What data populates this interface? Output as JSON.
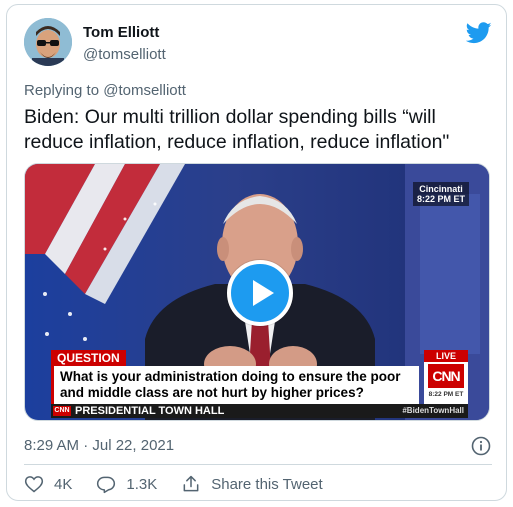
{
  "author": {
    "name": "Tom Elliott",
    "handle": "@tomselliott"
  },
  "replying_to": {
    "prefix": "Replying to",
    "mention": "@tomselliott"
  },
  "tweet": {
    "text": "Biden: Our multi trillion dollar spending bills “will reduce inflation, reduce inflation, reduce inflation\"",
    "timestamp": "8:29 AM · Jul 22, 2021"
  },
  "video": {
    "location": "Cincinnati",
    "location_time": "8:22 PM ET",
    "question_label": "QUESTION",
    "question_text": "What is your administration doing to ensure the poor and middle class are not hurt by higher prices?",
    "live_label": "LIVE",
    "network": "CNN",
    "live_time": "8:22 PM ET",
    "network_mini": "CNN",
    "program": "PRESIDENTIAL TOWN HALL",
    "hashtag": "#BidenTownHall"
  },
  "actions": {
    "likes": "4K",
    "replies": "1.3K",
    "share_label": "Share this Tweet"
  },
  "colors": {
    "twitter_blue": "#1d9bf0",
    "cnn_red": "#cc0000",
    "secondary_text": "#536471"
  }
}
